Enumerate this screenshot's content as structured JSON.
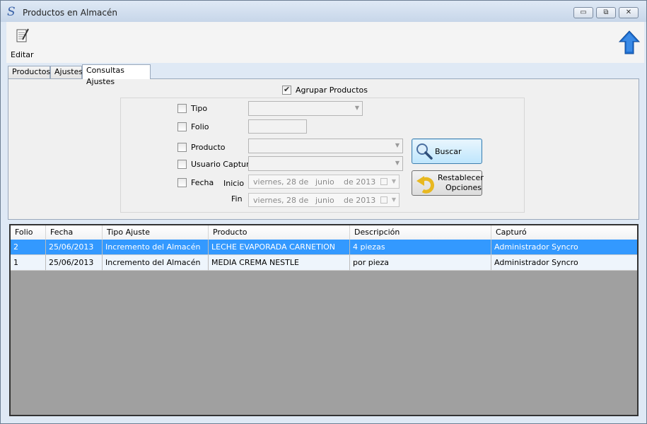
{
  "window": {
    "title": "Productos en Almacén",
    "minimize_glyph": "▭",
    "maximize_glyph": "⧉",
    "close_glyph": "✕"
  },
  "toolbar": {
    "edit_label": "Editar",
    "edit_icon": "edit-notepad-icon",
    "up_icon": "arrow-up-icon"
  },
  "tabs": [
    {
      "label": "Productos",
      "active": false
    },
    {
      "label": "Ajustes",
      "active": false
    },
    {
      "label": "Consultas Ajustes",
      "active": true
    }
  ],
  "filters": {
    "agrupar": {
      "label": "Agrupar Productos",
      "checked": true
    },
    "tipo": {
      "label": "Tipo",
      "checked": false,
      "value": ""
    },
    "folio": {
      "label": "Folio",
      "checked": false,
      "value": ""
    },
    "producto": {
      "label": "Producto",
      "checked": false,
      "value": ""
    },
    "usuario": {
      "label": "Usuario Capturó",
      "checked": false,
      "value": ""
    },
    "fecha": {
      "label": "Fecha",
      "checked": false
    },
    "inicio": {
      "label": "Inicio",
      "weekday": "viernes",
      "day": ", 28 de",
      "month": "junio",
      "year": "de 2013"
    },
    "fin": {
      "label": "Fin",
      "weekday": "viernes",
      "day": ", 28 de",
      "month": "junio",
      "year": "de 2013"
    }
  },
  "buttons": {
    "buscar": {
      "label": "Buscar",
      "icon": "magnifier-icon"
    },
    "restablecer": {
      "line1": "Restablecer",
      "line2": "Opciones",
      "icon": "undo-arrow-icon"
    }
  },
  "grid": {
    "columns": [
      "Folio",
      "Fecha",
      "Tipo Ajuste",
      "Producto",
      "Descripción",
      "Capturó"
    ],
    "rows": [
      {
        "cells": [
          "2",
          "25/06/2013",
          "Incremento del Almacén",
          "LECHE EVAPORADA CARNETION",
          "4 piezas",
          "Administrador  Syncro"
        ],
        "selected": true
      },
      {
        "cells": [
          "1",
          "25/06/2013",
          "Incremento del Almacén",
          "MEDIA CREMA NESTLE",
          "por pieza",
          "Administrador  Syncro"
        ],
        "selected": false
      }
    ]
  },
  "colors": {
    "selected_row": "#3399ff",
    "up_arrow": "#1f6fd0"
  }
}
